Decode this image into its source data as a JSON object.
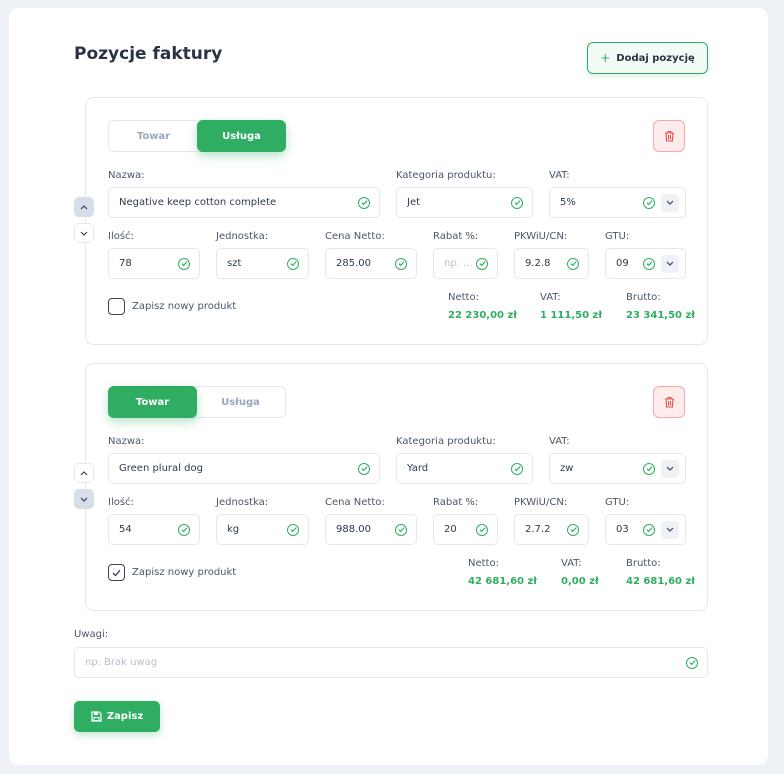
{
  "header": {
    "title": "Pozycje faktury",
    "add_label": "Dodaj pozycję"
  },
  "labels": {
    "nazwa": "Nazwa:",
    "kategoria": "Kategoria produktu:",
    "vat": "VAT:",
    "ilosc": "Ilość:",
    "jednostka": "Jednostka:",
    "cena": "Cena Netto:",
    "rabat": "Rabat %:",
    "pkwiu": "PKWiU/CN:",
    "gtu": "GTU:",
    "save_product": "Zapisz nowy produkt",
    "netto": "Netto:",
    "vat_sum": "VAT:",
    "brutto": "Brutto:"
  },
  "segment": {
    "towar": "Towar",
    "usluga": "Usługa"
  },
  "items": [
    {
      "type": "usluga",
      "nazwa": "Negative keep cotton complete",
      "kategoria": "Jet",
      "vat": "5%",
      "ilosc": "78",
      "jednostka": "szt",
      "cena": "285.00",
      "rabat": "",
      "rabat_placeholder": "np. ...",
      "pkwiu": "9.2.8",
      "gtu": "09",
      "save_product": false,
      "netto": "22 230,00 zł",
      "vat_amount": "1 111,50 zł",
      "brutto": "23 341,50 zł"
    },
    {
      "type": "towar",
      "nazwa": "Green plural dog",
      "kategoria": "Yard",
      "vat": "zw",
      "ilosc": "54",
      "jednostka": "kg",
      "cena": "988.00",
      "rabat": "20",
      "rabat_placeholder": "",
      "pkwiu": "2.7.2",
      "gtu": "03",
      "save_product": true,
      "netto": "42 681,60 zł",
      "vat_amount": "0,00 zł",
      "brutto": "42 681,60 zł"
    }
  ],
  "notes": {
    "label": "Uwagi:",
    "placeholder": "np. Brak uwag"
  },
  "footer": {
    "save_label": "Zapisz"
  },
  "colors": {
    "accent": "#2fae63",
    "danger": "#e0524c",
    "text": "#2e3a4f"
  }
}
